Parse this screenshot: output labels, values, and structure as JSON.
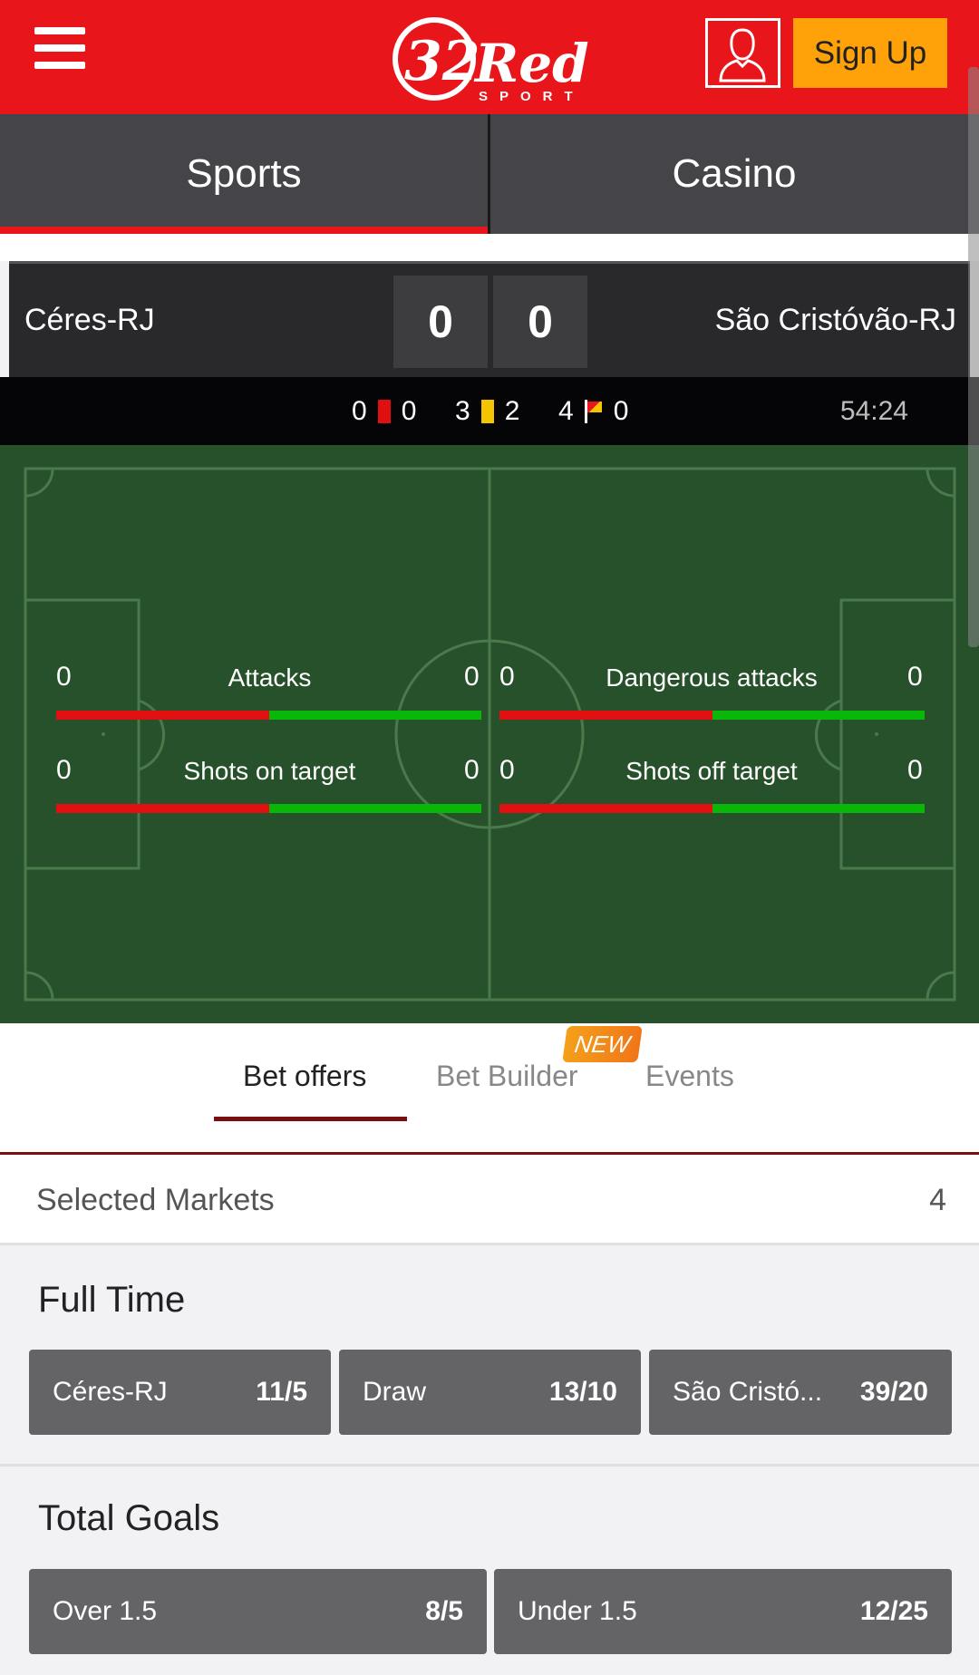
{
  "header": {
    "logo_text": "32Red",
    "logo_sub": "SPORT",
    "signup_label": "Sign Up"
  },
  "main_tabs": {
    "sports": "Sports",
    "casino": "Casino"
  },
  "match": {
    "home_team": "Céres-RJ",
    "away_team": "São Cristóvão-RJ",
    "home_score": "0",
    "away_score": "0",
    "red_cards": {
      "home": "0",
      "away": "0"
    },
    "yellow_cards": {
      "home": "3",
      "away": "2"
    },
    "corners": {
      "home": "4",
      "away": "0"
    },
    "time": "54:24"
  },
  "pitch_stats": [
    {
      "label": "Attacks",
      "home": "0",
      "away": "0"
    },
    {
      "label": "Dangerous attacks",
      "home": "0",
      "away": "0"
    },
    {
      "label": "Shots on target",
      "home": "0",
      "away": "0"
    },
    {
      "label": "Shots off target",
      "home": "0",
      "away": "0"
    }
  ],
  "bet_tabs": {
    "bet_offers": "Bet offers",
    "bet_builder": "Bet Builder",
    "new_badge": "NEW",
    "events": "Events"
  },
  "selected_markets": {
    "label": "Selected Markets",
    "count": "4"
  },
  "markets": {
    "full_time": {
      "title": "Full Time",
      "outcomes": [
        {
          "label": "Céres-RJ",
          "price": "11/5"
        },
        {
          "label": "Draw",
          "price": "13/10"
        },
        {
          "label": "São Cristó...",
          "price": "39/20"
        }
      ]
    },
    "total_goals": {
      "title": "Total Goals",
      "outcomes": [
        {
          "label": "Over 1.5",
          "price": "8/5"
        },
        {
          "label": "Under 1.5",
          "price": "12/25"
        }
      ]
    }
  },
  "colors": {
    "brand_red": "#e8151b",
    "signup_orange": "#ffa20a",
    "pitch_green": "#27512a",
    "home_bar": "#e01010",
    "away_bar": "#08b708"
  }
}
